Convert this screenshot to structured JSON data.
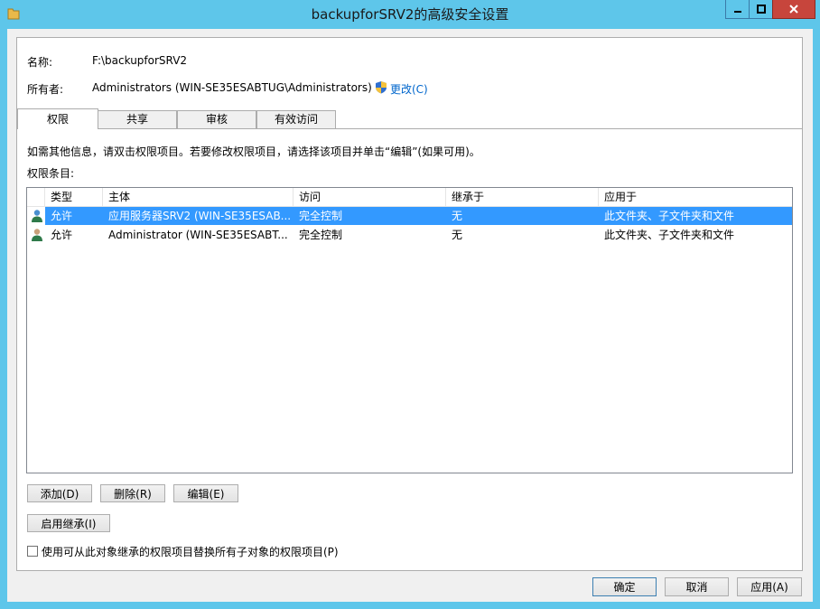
{
  "window": {
    "title": "backupforSRV2的高级安全设置"
  },
  "info": {
    "name_label": "名称:",
    "name_value": "F:\\backupforSRV2",
    "owner_label": "所有者:",
    "owner_value": "Administrators (WIN-SE35ESABTUG\\Administrators)",
    "change_link": "更改(C)"
  },
  "tabs": [
    {
      "label": "权限",
      "active": true
    },
    {
      "label": "共享"
    },
    {
      "label": "审核"
    },
    {
      "label": "有效访问"
    }
  ],
  "instruction": "如需其他信息，请双击权限项目。若要修改权限项目，请选择该项目并单击“编辑”(如果可用)。",
  "entries_label": "权限条目:",
  "columns": [
    "类型",
    "主体",
    "访问",
    "继承于",
    "应用于"
  ],
  "rows": [
    {
      "type": "允许",
      "principal": "应用服务器SRV2 (WIN-SE35ESAB...",
      "access": "完全控制",
      "inherited": "无",
      "applies": "此文件夹、子文件夹和文件",
      "selected": true
    },
    {
      "type": "允许",
      "principal": "Administrator (WIN-SE35ESABT...",
      "access": "完全控制",
      "inherited": "无",
      "applies": "此文件夹、子文件夹和文件",
      "selected": false
    }
  ],
  "buttons": {
    "add": "添加(D)",
    "remove": "删除(R)",
    "edit": "编辑(E)",
    "enable_inherit": "启用继承(I)",
    "ok": "确定",
    "cancel": "取消",
    "apply": "应用(A)"
  },
  "replace_checkbox": {
    "label": "使用可从此对象继承的权限项目替换所有子对象的权限项目(P)",
    "checked": false
  },
  "colors": {
    "titlebar": "#5ec6ea",
    "selection": "#3399ff",
    "link": "#0066cc",
    "close": "#c7453c"
  }
}
